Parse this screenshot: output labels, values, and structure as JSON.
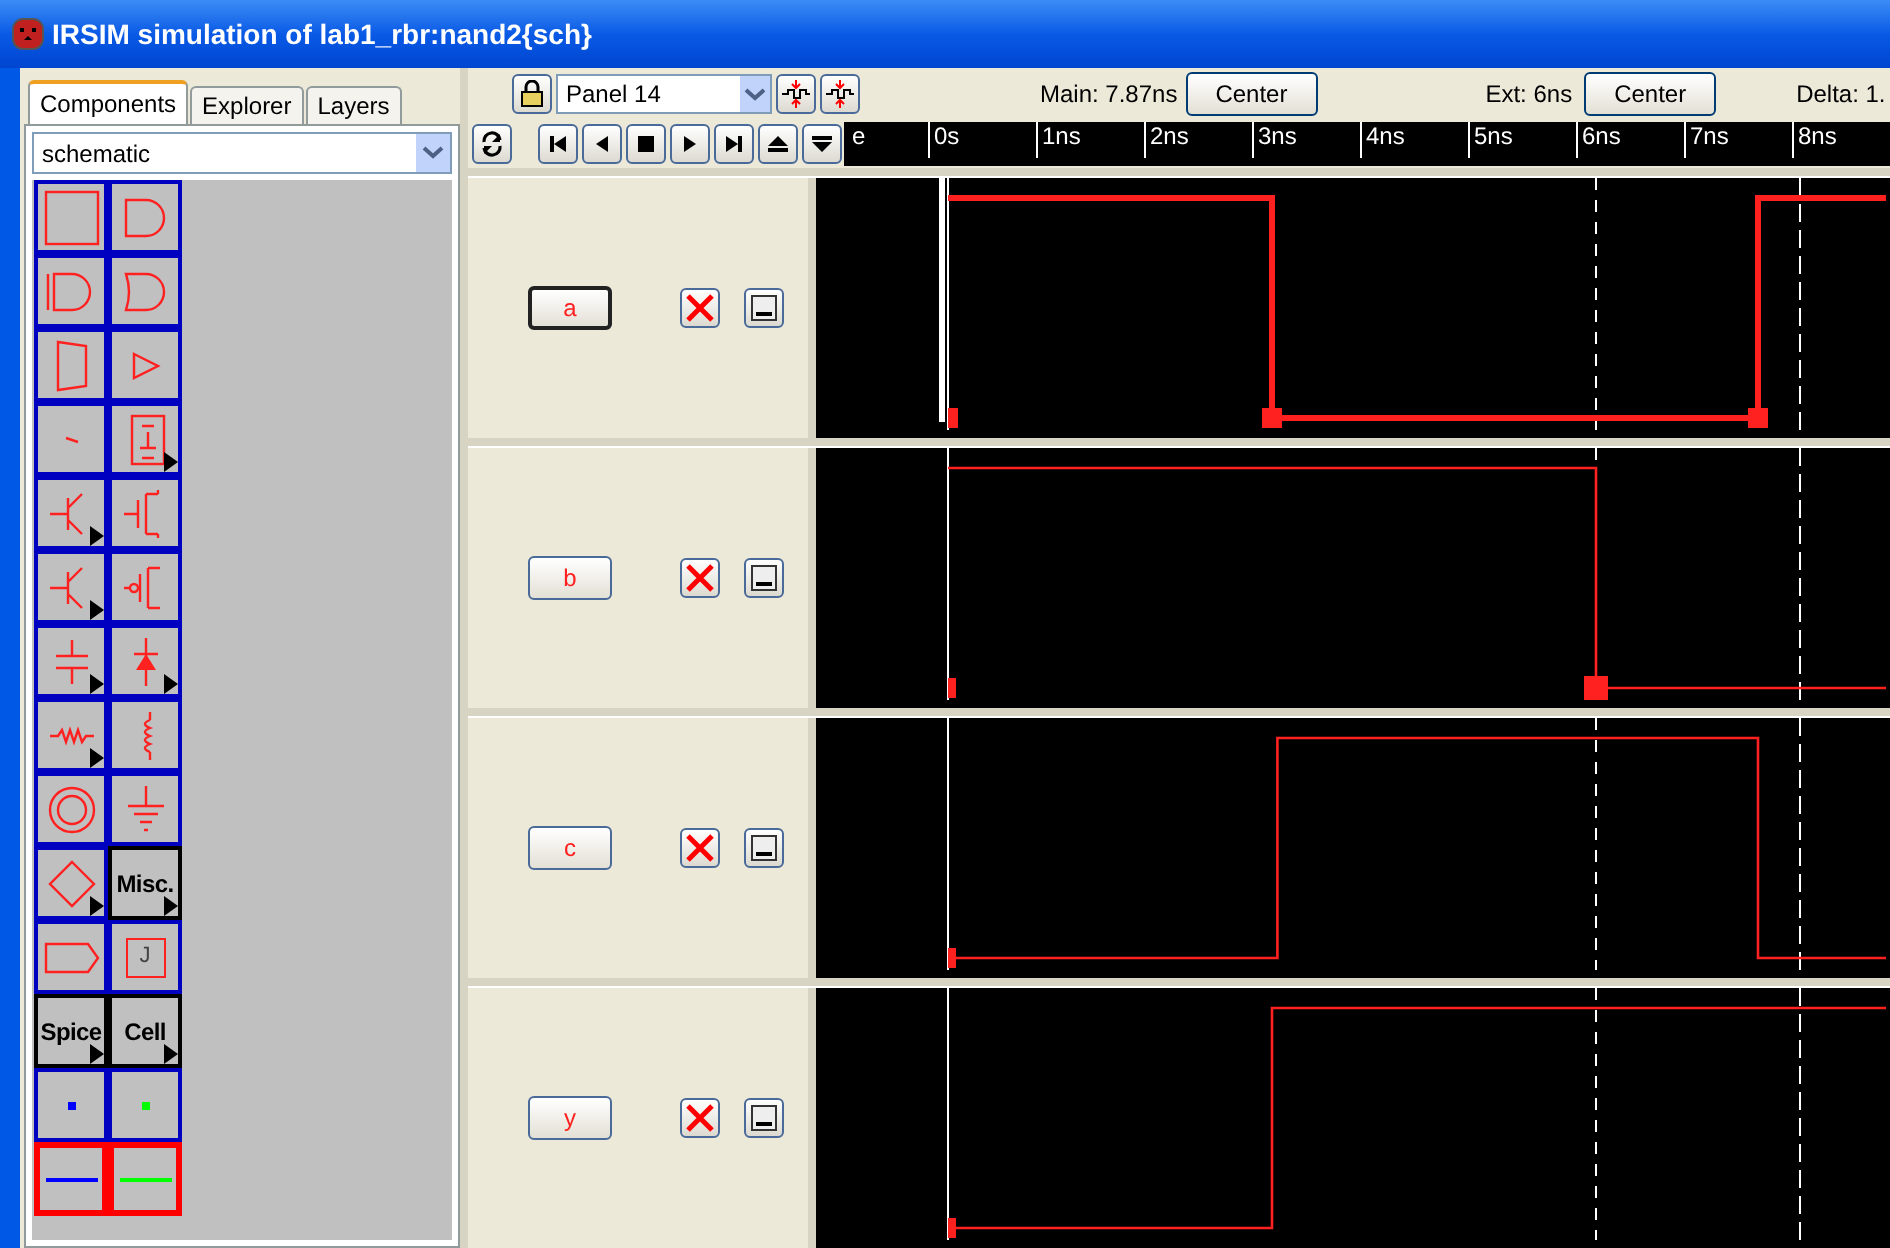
{
  "window": {
    "title": "IRSIM simulation of lab1_rbr:nand2{sch}"
  },
  "tabs": [
    {
      "label": "Components",
      "selected": true
    },
    {
      "label": "Explorer",
      "selected": false
    },
    {
      "label": "Layers",
      "selected": false
    }
  ],
  "technology_select": {
    "value": "schematic"
  },
  "palette": [
    {
      "kind": "box",
      "menu": false,
      "selected": false
    },
    {
      "kind": "and",
      "menu": false,
      "selected": false
    },
    {
      "kind": "xor",
      "menu": false,
      "selected": false
    },
    {
      "kind": "or",
      "menu": false,
      "selected": false
    },
    {
      "kind": "mux",
      "menu": false,
      "selected": false
    },
    {
      "kind": "buffer",
      "menu": false,
      "selected": false
    },
    {
      "kind": "arc",
      "menu": false,
      "selected": false
    },
    {
      "kind": "flipflop",
      "menu": true,
      "selected": false
    },
    {
      "kind": "bjt",
      "menu": true,
      "selected": false
    },
    {
      "kind": "nmos",
      "menu": false,
      "selected": false
    },
    {
      "kind": "bjt",
      "menu": true,
      "selected": false
    },
    {
      "kind": "pmos",
      "menu": false,
      "selected": false
    },
    {
      "kind": "capacitor",
      "menu": true,
      "selected": false
    },
    {
      "kind": "diode",
      "menu": true,
      "selected": false
    },
    {
      "kind": "resistor",
      "menu": true,
      "selected": false
    },
    {
      "kind": "inductor",
      "menu": false,
      "selected": false
    },
    {
      "kind": "source",
      "menu": false,
      "selected": false
    },
    {
      "kind": "ground",
      "menu": false,
      "selected": false
    },
    {
      "kind": "diamond",
      "menu": true,
      "selected": false
    },
    {
      "kind": "text",
      "label": "Misc.",
      "menu": true,
      "selected": false
    },
    {
      "kind": "offpage",
      "menu": false,
      "selected": false
    },
    {
      "kind": "pin",
      "label": "J",
      "menu": false,
      "selected": false
    },
    {
      "kind": "text",
      "label": "Spice",
      "menu": true,
      "selected": false
    },
    {
      "kind": "text",
      "label": "Cell",
      "menu": true,
      "selected": false
    },
    {
      "kind": "dot",
      "color": "#0000ff",
      "menu": false,
      "selected": false
    },
    {
      "kind": "dot",
      "color": "#00ff00",
      "menu": false,
      "selected": false
    },
    {
      "kind": "wire",
      "color": "#0000ff",
      "menu": false,
      "selected": true
    },
    {
      "kind": "wire",
      "color": "#00ff00",
      "menu": false,
      "selected": true
    }
  ],
  "panel_select": {
    "value": "Panel 14"
  },
  "main_cursor": {
    "label": "Main: 7.87ns",
    "button": "Center"
  },
  "ext_cursor": {
    "label": "Ext: 6ns",
    "button": "Center"
  },
  "delta": {
    "label": "Delta: 1."
  },
  "ruler": {
    "partial": "e",
    "ticks": [
      "0s",
      "1ns",
      "2ns",
      "3ns",
      "4ns",
      "5ns",
      "6ns",
      "7ns",
      "8ns"
    ]
  },
  "signals": [
    {
      "name": "a",
      "selected": true
    },
    {
      "name": "b",
      "selected": false
    },
    {
      "name": "c",
      "selected": false
    },
    {
      "name": "y",
      "selected": false
    }
  ]
}
